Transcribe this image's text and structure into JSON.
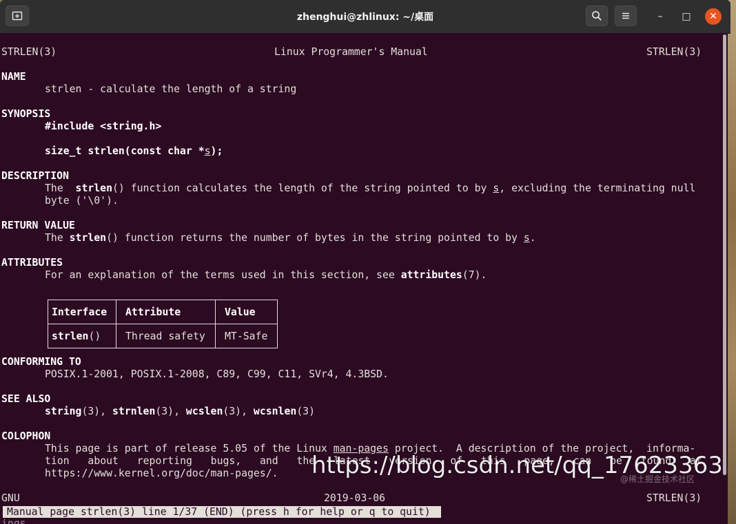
{
  "window": {
    "title": "zhenghui@zhlinux: ~/桌面",
    "newtab_icon": "new-tab-icon",
    "search_icon": "search-icon",
    "menu_icon": "hamburger-menu-icon",
    "minimize_glyph": "–",
    "maximize_glyph": "□",
    "close_glyph": "✕",
    "accent_close": "#e95420"
  },
  "terminal": {
    "background": "#2c0a22",
    "header": {
      "left": "STRLEN(3)",
      "center": "Linux Programmer's Manual",
      "right": "STRLEN(3)"
    },
    "name": {
      "heading": "NAME",
      "text": "strlen - calculate the length of a string"
    },
    "synopsis": {
      "heading": "SYNOPSIS",
      "include": "#include <string.h>",
      "proto_start": "size_t strlen(const char *",
      "proto_arg": "s",
      "proto_end": ");"
    },
    "description": {
      "heading": "DESCRIPTION",
      "l1_a": "The  ",
      "l1_func": "strlen",
      "l1_b": "() function calculates the length of the string pointed to by ",
      "l1_arg": "s",
      "l1_c": ", excluding the terminating null",
      "l2": "byte ('\\0')."
    },
    "return_value": {
      "heading": "RETURN VALUE",
      "a": "The ",
      "func": "strlen",
      "b": "() function returns the number of bytes in the string pointed to by ",
      "arg": "s",
      "c": "."
    },
    "attributes": {
      "heading": "ATTRIBUTES",
      "a": "For an explanation of the terms used in this section, see ",
      "ref": "attributes",
      "b": "(7).",
      "table": {
        "headers": [
          "Interface",
          "Attribute",
          "Value"
        ],
        "row_func": "strlen",
        "row_paren": "()",
        "row_attr": "Thread safety",
        "row_value": "MT-Safe"
      }
    },
    "conforming_to": {
      "heading": "CONFORMING TO",
      "text": "POSIX.1-2001, POSIX.1-2008, C89, C99, C11, SVr4, 4.3BSD."
    },
    "see_also": {
      "heading": "SEE ALSO",
      "items": [
        {
          "name": "string",
          "suffix": "(3), "
        },
        {
          "name": "strnlen",
          "suffix": "(3), "
        },
        {
          "name": "wcslen",
          "suffix": "(3), "
        },
        {
          "name": "wcsnlen",
          "suffix": "(3)"
        }
      ]
    },
    "colophon": {
      "heading": "COLOPHON",
      "l1_a": "This page is part of release 5.05 of the Linux ",
      "l1_link": "man-pages",
      "l1_b": " project.  A description of the project,  informa‐",
      "l2_words": [
        "tion",
        "about",
        "reporting",
        "bugs,",
        "and",
        "the",
        "latest",
        "version",
        "of",
        "this",
        "page,",
        "can",
        "be",
        "found",
        "at"
      ],
      "l3": "https://www.kernel.org/doc/man-pages/."
    },
    "footer": {
      "left": "GNU",
      "center": "2019-03-06",
      "right": "STRLEN(3)"
    },
    "statusbar": "Manual page strlen(3) line 1/37 (END) (press h for help or q to quit)",
    "below_prompt": "ings"
  },
  "watermark": {
    "text": "https://blog.csdn.net/qq_17623363",
    "small": "@稀土掘金技术社区"
  }
}
